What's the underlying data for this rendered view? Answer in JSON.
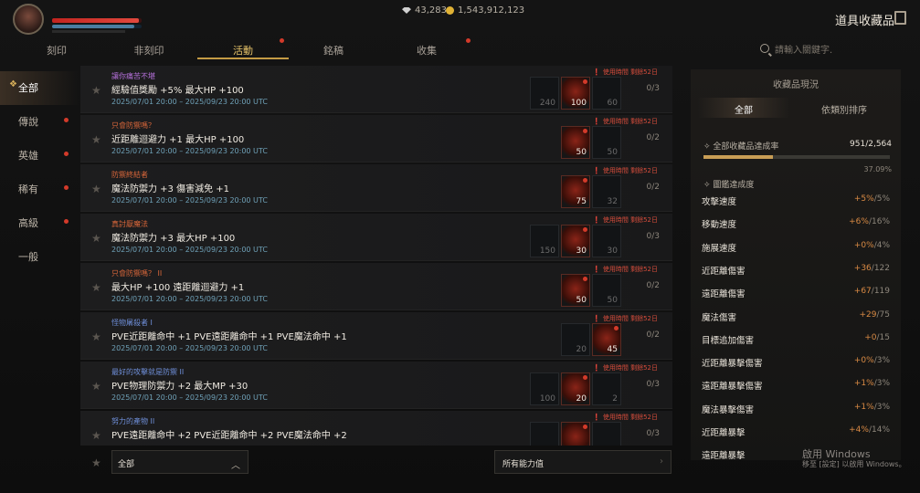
{
  "header": {
    "currency_gem": "43,283",
    "currency_gold": "1,543,912,123",
    "title": "道具收藏品",
    "hp_fraction": 0.97,
    "mp_fraction": 0.92
  },
  "tabs": [
    {
      "label": "刻印"
    },
    {
      "label": "非刻印"
    },
    {
      "label": "活動"
    },
    {
      "label": "銘稿"
    },
    {
      "label": "收集"
    }
  ],
  "search": {
    "placeholder": "請輸入關鍵字."
  },
  "left_nav": [
    {
      "label": "全部"
    },
    {
      "label": "傳說"
    },
    {
      "label": "英雄"
    },
    {
      "label": "稀有"
    },
    {
      "label": "高級"
    },
    {
      "label": "一般"
    }
  ],
  "rows": [
    {
      "name": "讓你痛苦不堪",
      "name_color": "#b36fd8",
      "desc": "經驗值獎勵 +5% 最大HP +100",
      "date": "2025/07/01 20:00 – 2025/09/23 20:00 UTC",
      "warn": "使用時間 剩餘52日",
      "progress": "0/3",
      "slots": [
        {
          "count": "240",
          "on": false
        },
        {
          "count": "100",
          "on": true
        },
        {
          "count": "60",
          "on": false
        }
      ]
    },
    {
      "name": "只會防禦嗎？",
      "name_color": "#d8663a",
      "desc": "近距離迴避力 +1 最大HP +100",
      "date": "2025/07/01 20:00 – 2025/09/23 20:00 UTC",
      "warn": "使用時間 剩餘52日",
      "progress": "0/2",
      "slots": [
        {
          "count": "50",
          "on": true
        },
        {
          "count": "50",
          "on": false
        }
      ]
    },
    {
      "name": "防禦終結者",
      "name_color": "#d8663a",
      "desc": "魔法防禦力 +3 傷害減免 +1",
      "date": "2025/07/01 20:00 – 2025/09/23 20:00 UTC",
      "warn": "使用時間 剩餘52日",
      "progress": "0/2",
      "slots": [
        {
          "count": "75",
          "on": true
        },
        {
          "count": "32",
          "on": false
        }
      ]
    },
    {
      "name": "真討厭魔法",
      "name_color": "#d8663a",
      "desc": "魔法防禦力 +3 最大HP +100",
      "date": "2025/07/01 20:00 – 2025/09/23 20:00 UTC",
      "warn": "使用時間 剩餘52日",
      "progress": "0/3",
      "slots": [
        {
          "count": "150",
          "on": false
        },
        {
          "count": "30",
          "on": true
        },
        {
          "count": "30",
          "on": false
        }
      ]
    },
    {
      "name": "只會防禦嗎？ II",
      "name_color": "#d8663a",
      "desc": "最大HP +100 遠距離迴避力 +1",
      "date": "2025/07/01 20:00 – 2025/09/23 20:00 UTC",
      "warn": "使用時間 剩餘52日",
      "progress": "0/2",
      "slots": [
        {
          "count": "50",
          "on": true
        },
        {
          "count": "50",
          "on": false
        }
      ]
    },
    {
      "name": "怪物屠殺者 I",
      "name_color": "#6e8ed8",
      "desc": "PVE近距離命中 +1 PVE遠距離命中 +1 PVE魔法命中 +1",
      "date": "2025/07/01 20:00 – 2025/09/23 20:00 UTC",
      "warn": "使用時間 剩餘52日",
      "progress": "0/2",
      "slots": [
        {
          "count": "20",
          "on": false
        },
        {
          "count": "45",
          "on": true
        }
      ]
    },
    {
      "name": "最好的攻擊就是防禦 II",
      "name_color": "#6e8ed8",
      "desc": "PVE物理防禦力 +2 最大MP +30",
      "date": "2025/07/01 20:00 – 2025/09/23 20:00 UTC",
      "warn": "使用時間 剩餘52日",
      "progress": "0/3",
      "slots": [
        {
          "count": "100",
          "on": false
        },
        {
          "count": "20",
          "on": true
        },
        {
          "count": "2",
          "on": false
        }
      ]
    },
    {
      "name": "努力的產物 II",
      "name_color": "#6e8ed8",
      "desc": "PVE遠距離命中 +2 PVE近距離命中 +2 PVE魔法命中 +2",
      "date": "",
      "warn": "使用時間 剩餘52日",
      "progress": "0/3",
      "slots": [
        {
          "count": "",
          "on": false
        },
        {
          "count": "",
          "on": true
        },
        {
          "count": "",
          "on": false
        }
      ]
    }
  ],
  "bottom": {
    "filter_label": "全部",
    "ability_label": "所有能力值"
  },
  "panel": {
    "title": "收藏品現況",
    "tab_all": "全部",
    "tab_sort": "依類別排序",
    "achieve_label": "全部收藏品達成率",
    "achieve_value": "951/2,564",
    "achieve_fraction": 0.3709,
    "achieve_pct": "37.09%",
    "section_label": "圖鑑達成度",
    "stats": [
      {
        "label": "攻擊速度",
        "cur": "+5%",
        "max": "/5%"
      },
      {
        "label": "移動速度",
        "cur": "+6%",
        "max": "/16%"
      },
      {
        "label": "施展速度",
        "cur": "+0%",
        "max": "/4%"
      },
      {
        "label": "近距離傷害",
        "cur": "+36",
        "max": "/122"
      },
      {
        "label": "遠距離傷害",
        "cur": "+67",
        "max": "/119"
      },
      {
        "label": "魔法傷害",
        "cur": "+29",
        "max": "/75"
      },
      {
        "label": "目標追加傷害",
        "cur": "+0",
        "max": "/15"
      },
      {
        "label": "近距離暴擊傷害",
        "cur": "+0%",
        "max": "/3%"
      },
      {
        "label": "遠距離暴擊傷害",
        "cur": "+1%",
        "max": "/3%"
      },
      {
        "label": "魔法暴擊傷害",
        "cur": "+1%",
        "max": "/3%"
      },
      {
        "label": "近距離暴擊",
        "cur": "+4%",
        "max": "/14%"
      },
      {
        "label": "遠距離暴擊",
        "cur": "",
        "max": ""
      }
    ]
  },
  "watermark": {
    "line1": "啟用 Windows",
    "line2": "移至 [設定] 以啟用 Windows。"
  }
}
